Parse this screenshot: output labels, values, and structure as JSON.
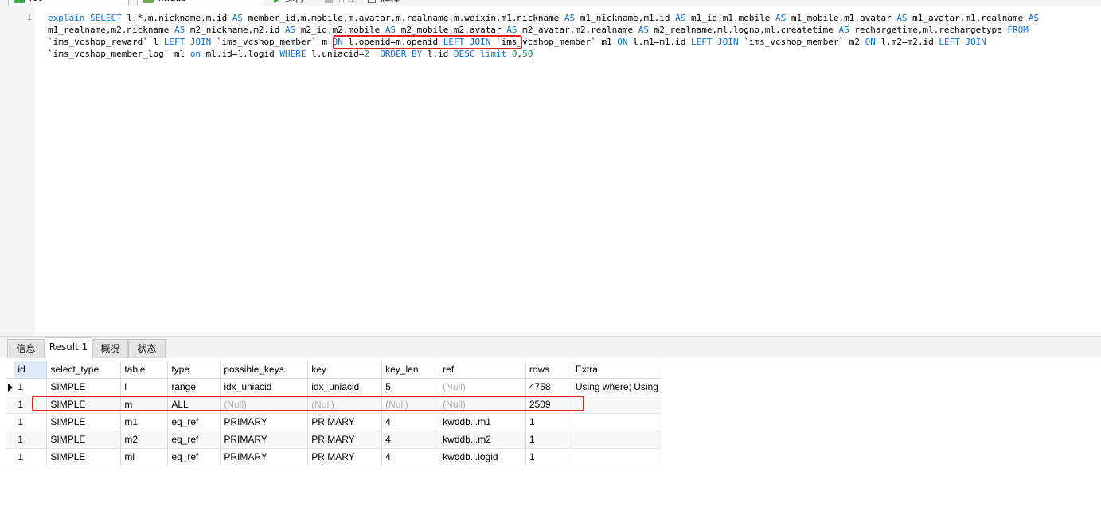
{
  "toolbar": {
    "connection_combo": "r00",
    "database_combo": "kwddb",
    "run_label": "运行",
    "stop_label": "停止",
    "explain_label": "解释"
  },
  "editor": {
    "line_number": "1"
  },
  "tabs": [
    "信息",
    "Result 1",
    "概况",
    "状态"
  ],
  "result": {
    "columns": [
      "id",
      "select_type",
      "table",
      "type",
      "possible_keys",
      "key",
      "key_len",
      "ref",
      "rows",
      "Extra"
    ],
    "rows": [
      [
        "1",
        "SIMPLE",
        "l",
        "range",
        "idx_uniacid",
        "idx_uniacid",
        "5",
        "(Null)",
        "4758",
        "Using where; Using"
      ],
      [
        "1",
        "SIMPLE",
        "m",
        "ALL",
        "(Null)",
        "(Null)",
        "(Null)",
        "(Null)",
        "2509",
        ""
      ],
      [
        "1",
        "SIMPLE",
        "m1",
        "eq_ref",
        "PRIMARY",
        "PRIMARY",
        "4",
        "kwddb.l.m1",
        "1",
        ""
      ],
      [
        "1",
        "SIMPLE",
        "m2",
        "eq_ref",
        "PRIMARY",
        "PRIMARY",
        "4",
        "kwddb.l.m2",
        "1",
        ""
      ],
      [
        "1",
        "SIMPLE",
        "ml",
        "eq_ref",
        "PRIMARY",
        "PRIMARY",
        "4",
        "kwddb.l.logid",
        "1",
        ""
      ]
    ]
  },
  "colors": {
    "keyword": "#0a6ed0",
    "number": "#098658",
    "highlight_box": "#e22222",
    "null_text": "#b0b0b0"
  }
}
